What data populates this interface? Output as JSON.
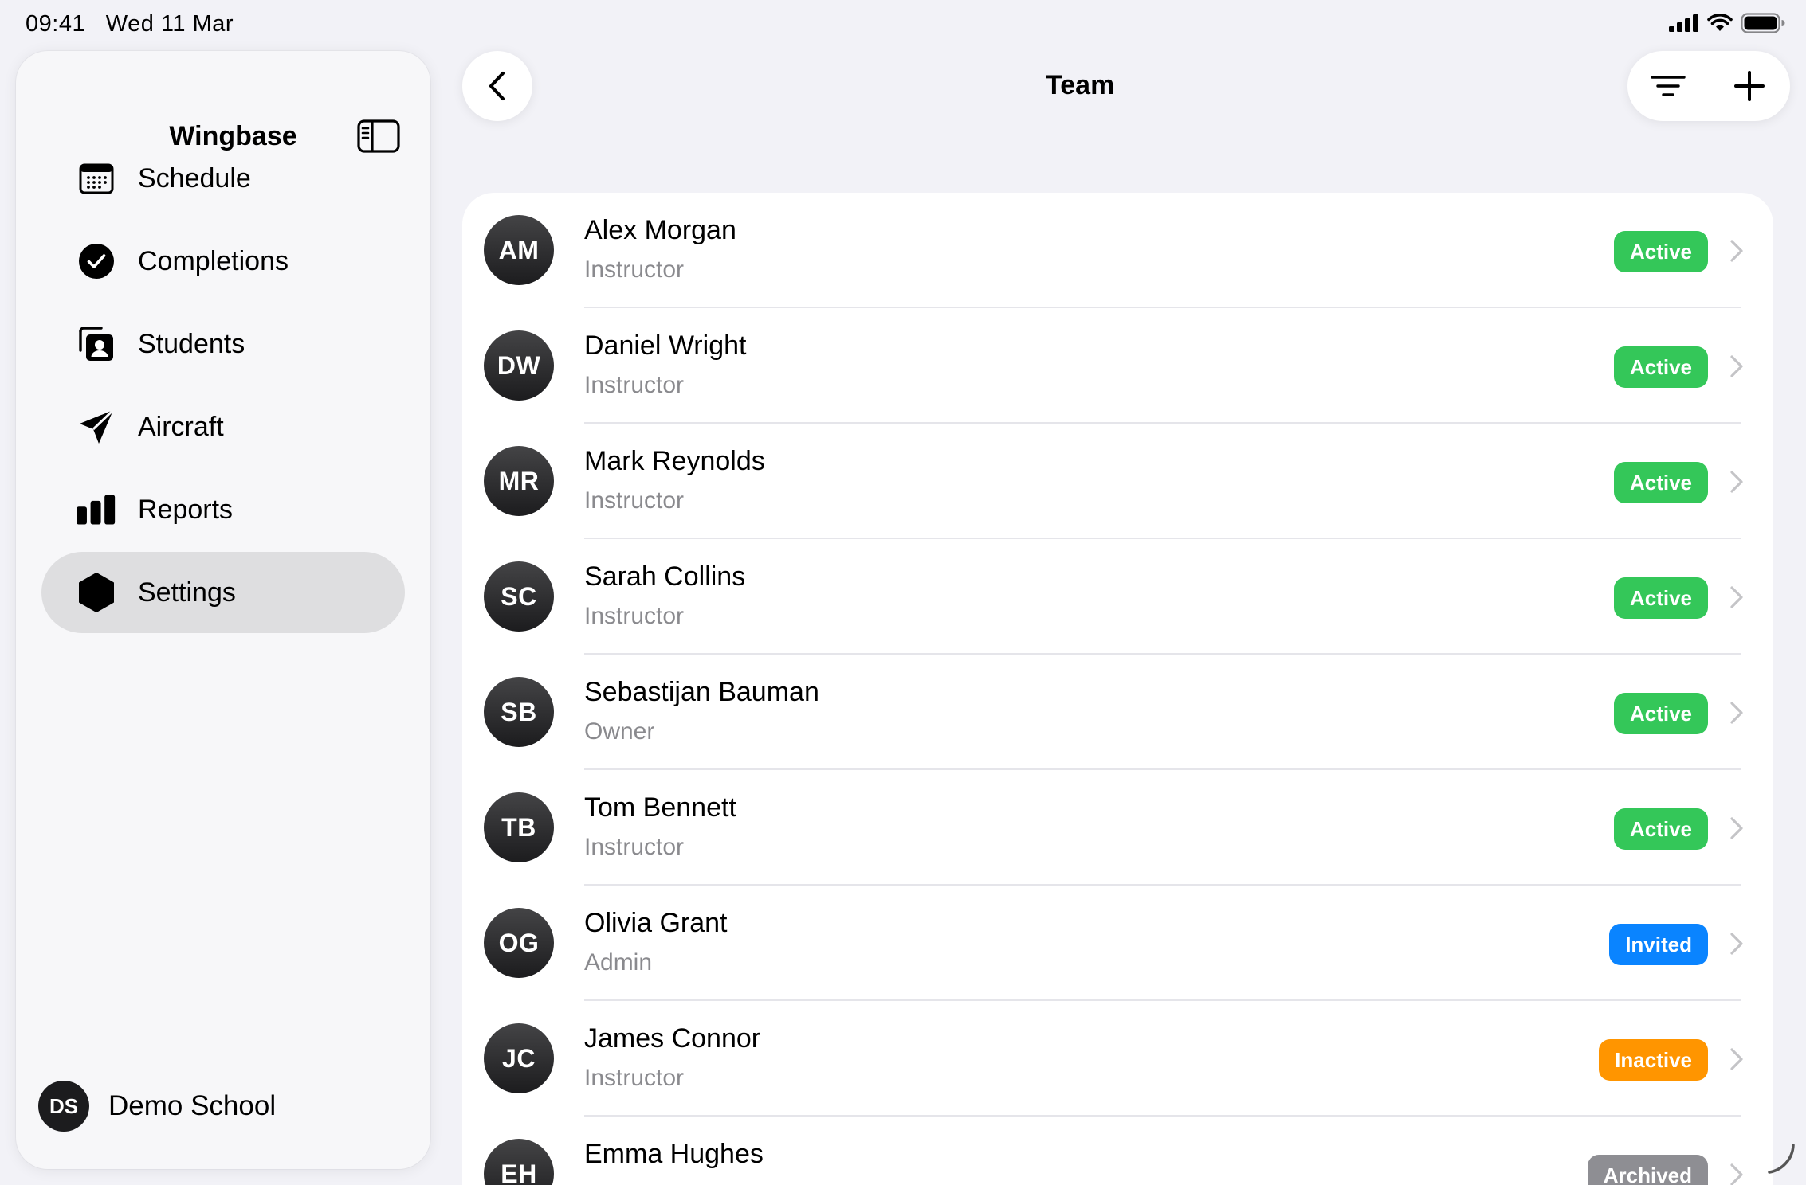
{
  "status_bar": {
    "time": "09:41",
    "date": "Wed 11 Mar"
  },
  "sidebar": {
    "title": "Wingbase",
    "items": [
      {
        "label": "Schedule",
        "icon": "calendar-icon",
        "selected": false
      },
      {
        "label": "Completions",
        "icon": "checkmark-circle-icon",
        "selected": false
      },
      {
        "label": "Students",
        "icon": "person-cards-icon",
        "selected": false
      },
      {
        "label": "Aircraft",
        "icon": "paperplane-icon",
        "selected": false
      },
      {
        "label": "Reports",
        "icon": "bar-chart-icon",
        "selected": false
      },
      {
        "label": "Settings",
        "icon": "hexagon-icon",
        "selected": true
      }
    ],
    "profile": {
      "initials": "DS",
      "name": "Demo School"
    }
  },
  "header": {
    "title": "Team"
  },
  "team": [
    {
      "initials": "AM",
      "name": "Alex Morgan",
      "role": "Instructor",
      "status": "Active",
      "status_color": "#34c759"
    },
    {
      "initials": "DW",
      "name": "Daniel Wright",
      "role": "Instructor",
      "status": "Active",
      "status_color": "#34c759"
    },
    {
      "initials": "MR",
      "name": "Mark Reynolds",
      "role": "Instructor",
      "status": "Active",
      "status_color": "#34c759"
    },
    {
      "initials": "SC",
      "name": "Sarah Collins",
      "role": "Instructor",
      "status": "Active",
      "status_color": "#34c759"
    },
    {
      "initials": "SB",
      "name": "Sebastijan Bauman",
      "role": "Owner",
      "status": "Active",
      "status_color": "#34c759"
    },
    {
      "initials": "TB",
      "name": "Tom Bennett",
      "role": "Instructor",
      "status": "Active",
      "status_color": "#34c759"
    },
    {
      "initials": "OG",
      "name": "Olivia Grant",
      "role": "Admin",
      "status": "Invited",
      "status_color": "#0a84ff"
    },
    {
      "initials": "JC",
      "name": "James Connor",
      "role": "Instructor",
      "status": "Inactive",
      "status_color": "#ff9500"
    },
    {
      "initials": "EH",
      "name": "Emma Hughes",
      "role": "",
      "status": "Archived",
      "status_color": "#8e8e93"
    }
  ]
}
